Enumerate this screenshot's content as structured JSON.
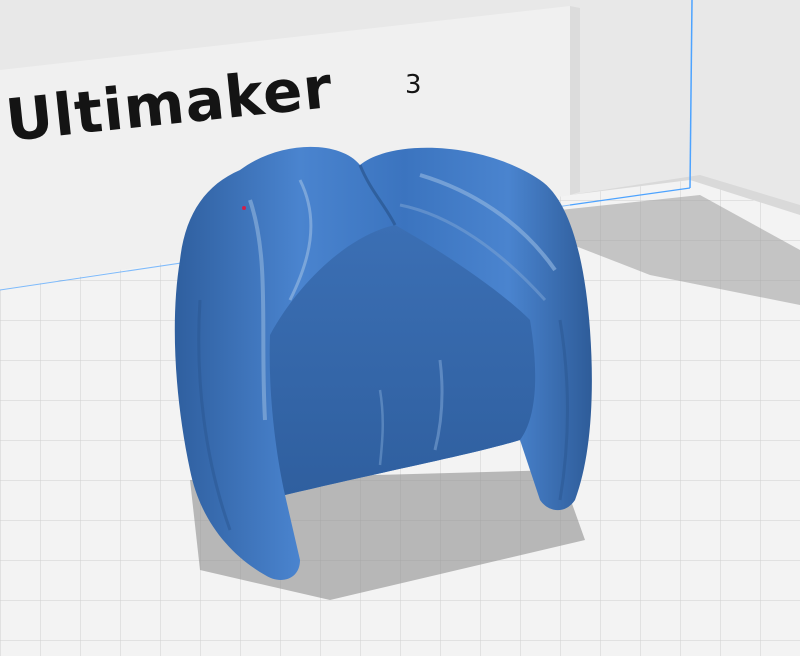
{
  "viewport": {
    "printer_backplate": {
      "brand_text": "Ultimaker",
      "model_mark": "3"
    },
    "colors": {
      "model_fill": "#3f78c4",
      "model_shade": "#2f5f9f",
      "model_highlight": "#86acd9",
      "build_plate": "#f2f2f2",
      "grid_line": "#c9c9c9",
      "shadow": "#8b8b8b",
      "axis_line": "#4da3ff"
    }
  }
}
